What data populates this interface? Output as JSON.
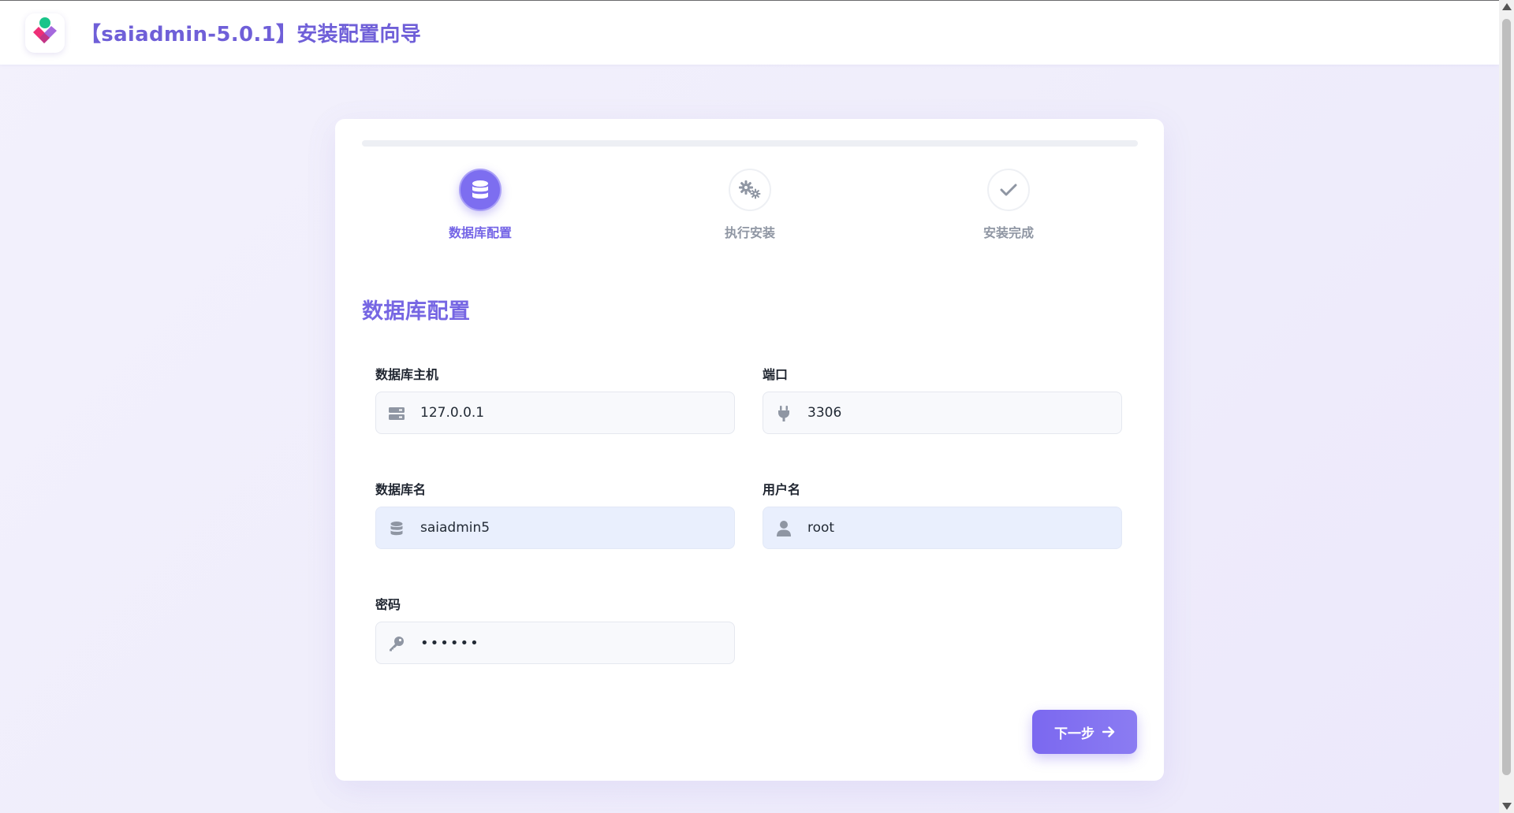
{
  "header": {
    "title": "【saiadmin-5.0.1】安装配置向导"
  },
  "wizard": {
    "progress_percent": 0,
    "steps": [
      {
        "label": "数据库配置",
        "icon": "database-icon",
        "state": "active"
      },
      {
        "label": "执行安装",
        "icon": "gears-icon",
        "state": "inactive"
      },
      {
        "label": "安装完成",
        "icon": "check-icon",
        "state": "inactive"
      }
    ]
  },
  "form": {
    "section_title": "数据库配置",
    "host": {
      "label": "数据库主机",
      "value": "127.0.0.1",
      "icon": "server-icon"
    },
    "port": {
      "label": "端口",
      "value": "3306",
      "icon": "plug-icon"
    },
    "dbname": {
      "label": "数据库名",
      "value": "saiadmin5",
      "icon": "database-icon"
    },
    "username": {
      "label": "用户名",
      "value": "root",
      "icon": "user-icon"
    },
    "password": {
      "label": "密码",
      "value": "123456",
      "icon": "key-icon"
    },
    "next_label": "下一步"
  },
  "colors": {
    "accent": "#7b68f0",
    "accent_text": "#7464e6",
    "muted_text": "#8f96a3"
  }
}
